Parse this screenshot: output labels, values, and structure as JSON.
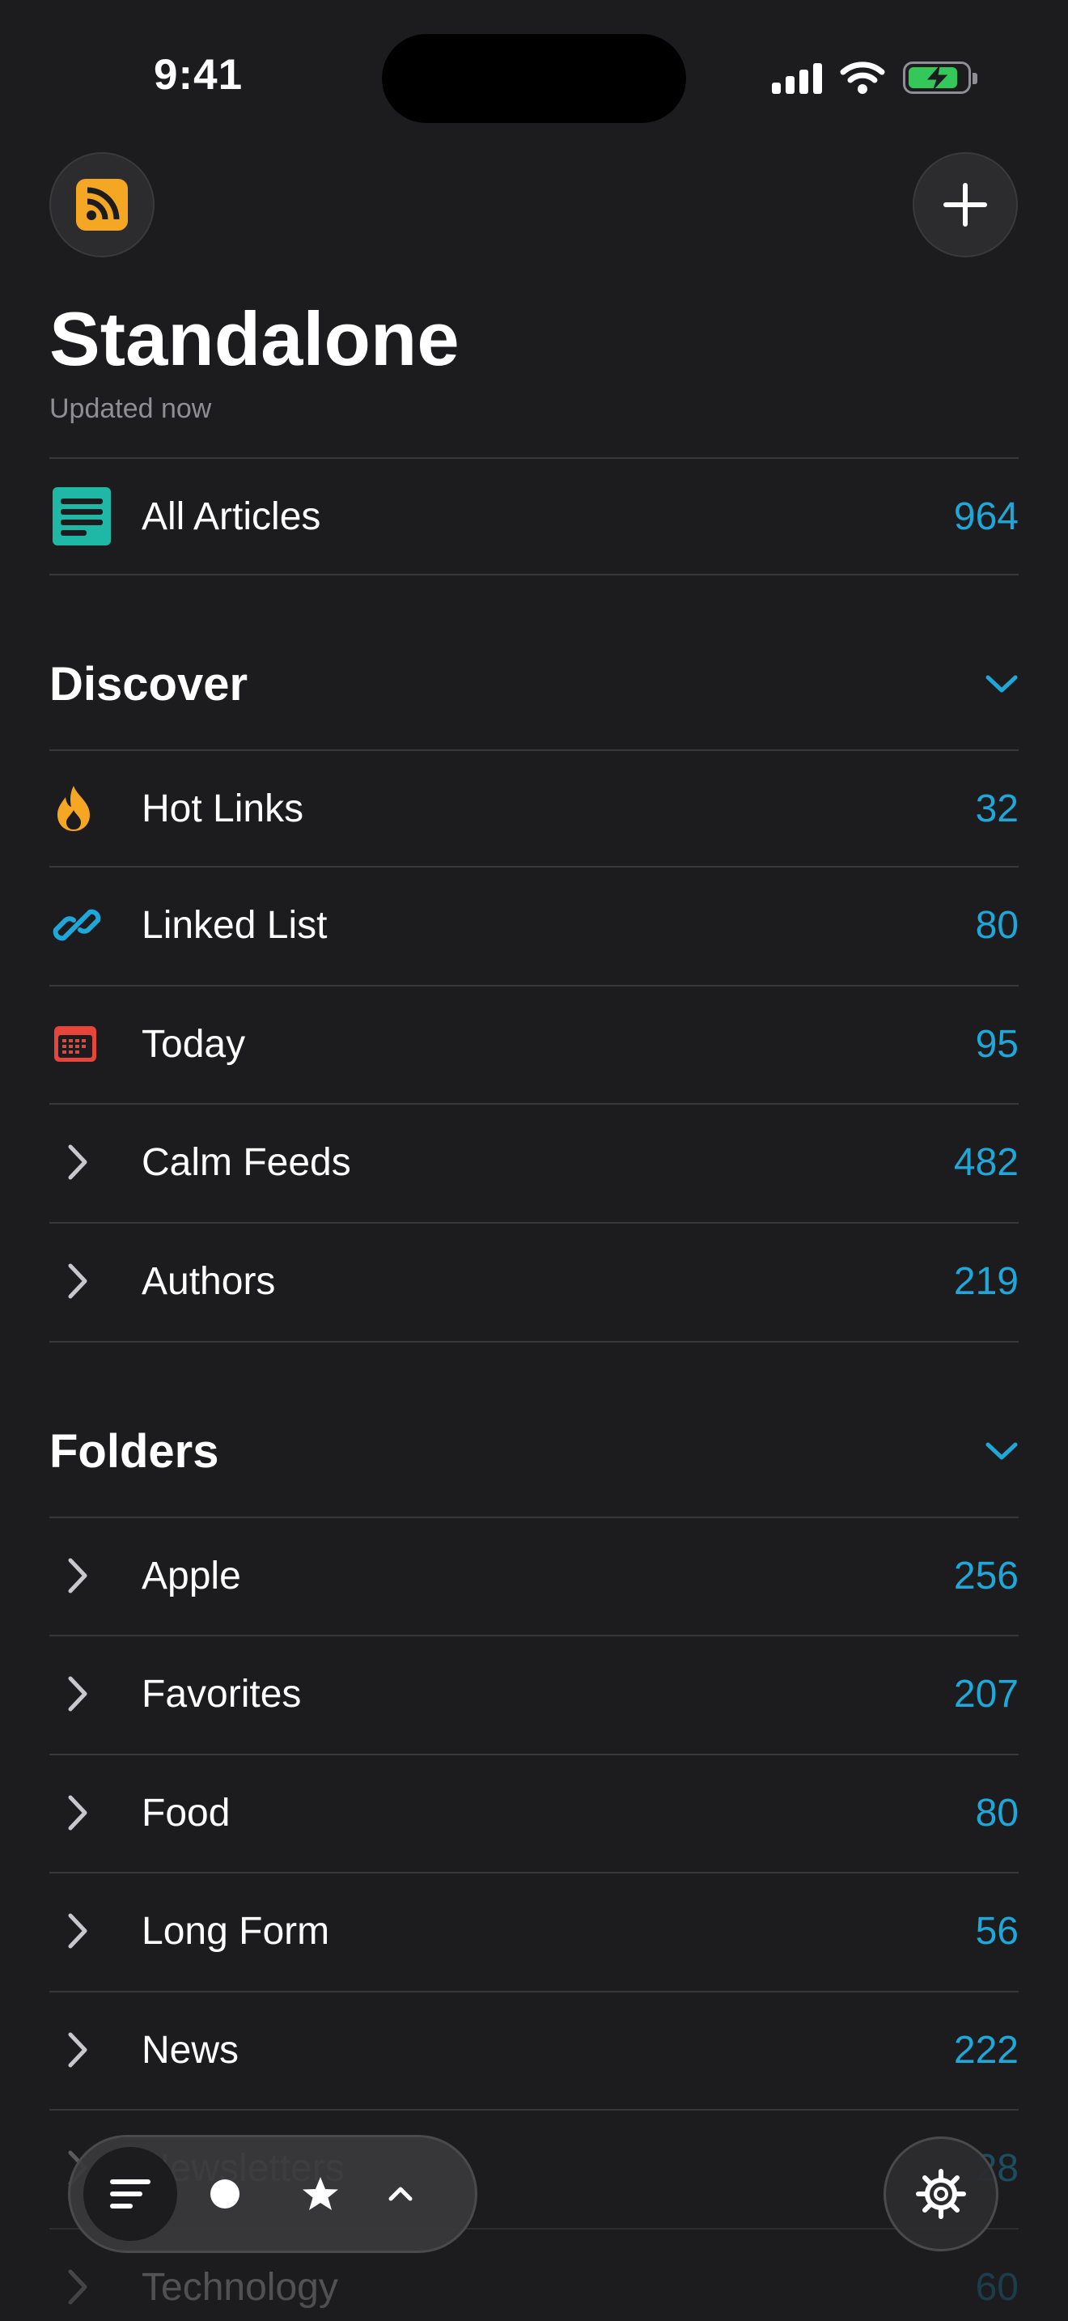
{
  "status_bar": {
    "time": "9:41"
  },
  "header": {
    "feeds_icon": "rss-icon",
    "add_icon": "plus-icon",
    "title": "Standalone",
    "subtitle": "Updated now"
  },
  "all_articles": {
    "label": "All Articles",
    "count": "964",
    "icon": "article-icon",
    "icon_color": "#1fb8a6"
  },
  "discover": {
    "title": "Discover",
    "items": [
      {
        "label": "Hot Links",
        "count": "32",
        "icon": "flame-icon",
        "icon_color": "#f5a623"
      },
      {
        "label": "Linked List",
        "count": "80",
        "icon": "link-icon",
        "icon_color": "#1ea7d8"
      },
      {
        "label": "Today",
        "count": "95",
        "icon": "calendar-icon",
        "icon_color": "#e5453a"
      },
      {
        "label": "Calm Feeds",
        "count": "482",
        "icon": "chevron-right-icon"
      },
      {
        "label": "Authors",
        "count": "219",
        "icon": "chevron-right-icon"
      }
    ]
  },
  "folders": {
    "title": "Folders",
    "items": [
      {
        "label": "Apple",
        "count": "256"
      },
      {
        "label": "Favorites",
        "count": "207"
      },
      {
        "label": "Food",
        "count": "80"
      },
      {
        "label": "Long Form",
        "count": "56"
      },
      {
        "label": "News",
        "count": "222"
      },
      {
        "label": "Newsletters",
        "count": "28"
      },
      {
        "label": "Technology",
        "count": "60"
      }
    ]
  },
  "toolbar": {
    "items": [
      "list-icon",
      "unread-dot-icon",
      "star-icon",
      "chevron-up-icon"
    ],
    "settings_icon": "gear-icon"
  },
  "colors": {
    "accent": "#1ea7d8",
    "background": "#1c1c1e",
    "separator": "#38383a"
  }
}
